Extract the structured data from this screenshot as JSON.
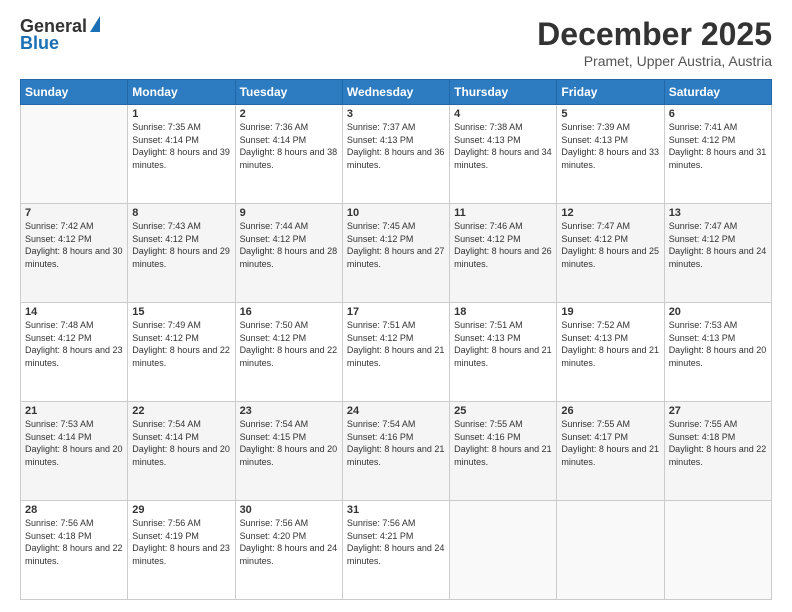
{
  "logo": {
    "line1": "General",
    "line2": "Blue"
  },
  "title": "December 2025",
  "subtitle": "Pramet, Upper Austria, Austria",
  "weekdays": [
    "Sunday",
    "Monday",
    "Tuesday",
    "Wednesday",
    "Thursday",
    "Friday",
    "Saturday"
  ],
  "weeks": [
    [
      {
        "day": "",
        "sunrise": "",
        "sunset": "",
        "daylight": ""
      },
      {
        "day": "1",
        "sunrise": "Sunrise: 7:35 AM",
        "sunset": "Sunset: 4:14 PM",
        "daylight": "Daylight: 8 hours and 39 minutes."
      },
      {
        "day": "2",
        "sunrise": "Sunrise: 7:36 AM",
        "sunset": "Sunset: 4:14 PM",
        "daylight": "Daylight: 8 hours and 38 minutes."
      },
      {
        "day": "3",
        "sunrise": "Sunrise: 7:37 AM",
        "sunset": "Sunset: 4:13 PM",
        "daylight": "Daylight: 8 hours and 36 minutes."
      },
      {
        "day": "4",
        "sunrise": "Sunrise: 7:38 AM",
        "sunset": "Sunset: 4:13 PM",
        "daylight": "Daylight: 8 hours and 34 minutes."
      },
      {
        "day": "5",
        "sunrise": "Sunrise: 7:39 AM",
        "sunset": "Sunset: 4:13 PM",
        "daylight": "Daylight: 8 hours and 33 minutes."
      },
      {
        "day": "6",
        "sunrise": "Sunrise: 7:41 AM",
        "sunset": "Sunset: 4:12 PM",
        "daylight": "Daylight: 8 hours and 31 minutes."
      }
    ],
    [
      {
        "day": "7",
        "sunrise": "Sunrise: 7:42 AM",
        "sunset": "Sunset: 4:12 PM",
        "daylight": "Daylight: 8 hours and 30 minutes."
      },
      {
        "day": "8",
        "sunrise": "Sunrise: 7:43 AM",
        "sunset": "Sunset: 4:12 PM",
        "daylight": "Daylight: 8 hours and 29 minutes."
      },
      {
        "day": "9",
        "sunrise": "Sunrise: 7:44 AM",
        "sunset": "Sunset: 4:12 PM",
        "daylight": "Daylight: 8 hours and 28 minutes."
      },
      {
        "day": "10",
        "sunrise": "Sunrise: 7:45 AM",
        "sunset": "Sunset: 4:12 PM",
        "daylight": "Daylight: 8 hours and 27 minutes."
      },
      {
        "day": "11",
        "sunrise": "Sunrise: 7:46 AM",
        "sunset": "Sunset: 4:12 PM",
        "daylight": "Daylight: 8 hours and 26 minutes."
      },
      {
        "day": "12",
        "sunrise": "Sunrise: 7:47 AM",
        "sunset": "Sunset: 4:12 PM",
        "daylight": "Daylight: 8 hours and 25 minutes."
      },
      {
        "day": "13",
        "sunrise": "Sunrise: 7:47 AM",
        "sunset": "Sunset: 4:12 PM",
        "daylight": "Daylight: 8 hours and 24 minutes."
      }
    ],
    [
      {
        "day": "14",
        "sunrise": "Sunrise: 7:48 AM",
        "sunset": "Sunset: 4:12 PM",
        "daylight": "Daylight: 8 hours and 23 minutes."
      },
      {
        "day": "15",
        "sunrise": "Sunrise: 7:49 AM",
        "sunset": "Sunset: 4:12 PM",
        "daylight": "Daylight: 8 hours and 22 minutes."
      },
      {
        "day": "16",
        "sunrise": "Sunrise: 7:50 AM",
        "sunset": "Sunset: 4:12 PM",
        "daylight": "Daylight: 8 hours and 22 minutes."
      },
      {
        "day": "17",
        "sunrise": "Sunrise: 7:51 AM",
        "sunset": "Sunset: 4:12 PM",
        "daylight": "Daylight: 8 hours and 21 minutes."
      },
      {
        "day": "18",
        "sunrise": "Sunrise: 7:51 AM",
        "sunset": "Sunset: 4:13 PM",
        "daylight": "Daylight: 8 hours and 21 minutes."
      },
      {
        "day": "19",
        "sunrise": "Sunrise: 7:52 AM",
        "sunset": "Sunset: 4:13 PM",
        "daylight": "Daylight: 8 hours and 21 minutes."
      },
      {
        "day": "20",
        "sunrise": "Sunrise: 7:53 AM",
        "sunset": "Sunset: 4:13 PM",
        "daylight": "Daylight: 8 hours and 20 minutes."
      }
    ],
    [
      {
        "day": "21",
        "sunrise": "Sunrise: 7:53 AM",
        "sunset": "Sunset: 4:14 PM",
        "daylight": "Daylight: 8 hours and 20 minutes."
      },
      {
        "day": "22",
        "sunrise": "Sunrise: 7:54 AM",
        "sunset": "Sunset: 4:14 PM",
        "daylight": "Daylight: 8 hours and 20 minutes."
      },
      {
        "day": "23",
        "sunrise": "Sunrise: 7:54 AM",
        "sunset": "Sunset: 4:15 PM",
        "daylight": "Daylight: 8 hours and 20 minutes."
      },
      {
        "day": "24",
        "sunrise": "Sunrise: 7:54 AM",
        "sunset": "Sunset: 4:16 PM",
        "daylight": "Daylight: 8 hours and 21 minutes."
      },
      {
        "day": "25",
        "sunrise": "Sunrise: 7:55 AM",
        "sunset": "Sunset: 4:16 PM",
        "daylight": "Daylight: 8 hours and 21 minutes."
      },
      {
        "day": "26",
        "sunrise": "Sunrise: 7:55 AM",
        "sunset": "Sunset: 4:17 PM",
        "daylight": "Daylight: 8 hours and 21 minutes."
      },
      {
        "day": "27",
        "sunrise": "Sunrise: 7:55 AM",
        "sunset": "Sunset: 4:18 PM",
        "daylight": "Daylight: 8 hours and 22 minutes."
      }
    ],
    [
      {
        "day": "28",
        "sunrise": "Sunrise: 7:56 AM",
        "sunset": "Sunset: 4:18 PM",
        "daylight": "Daylight: 8 hours and 22 minutes."
      },
      {
        "day": "29",
        "sunrise": "Sunrise: 7:56 AM",
        "sunset": "Sunset: 4:19 PM",
        "daylight": "Daylight: 8 hours and 23 minutes."
      },
      {
        "day": "30",
        "sunrise": "Sunrise: 7:56 AM",
        "sunset": "Sunset: 4:20 PM",
        "daylight": "Daylight: 8 hours and 24 minutes."
      },
      {
        "day": "31",
        "sunrise": "Sunrise: 7:56 AM",
        "sunset": "Sunset: 4:21 PM",
        "daylight": "Daylight: 8 hours and 24 minutes."
      },
      {
        "day": "",
        "sunrise": "",
        "sunset": "",
        "daylight": ""
      },
      {
        "day": "",
        "sunrise": "",
        "sunset": "",
        "daylight": ""
      },
      {
        "day": "",
        "sunrise": "",
        "sunset": "",
        "daylight": ""
      }
    ]
  ]
}
